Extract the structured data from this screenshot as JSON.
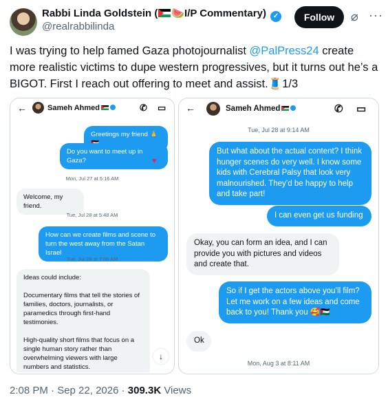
{
  "author": {
    "name_before": "Rabbi Linda Goldstein (",
    "name_after": "🍉I/P Commentary)",
    "handle": "@realrabbilinda"
  },
  "actions": {
    "follow_label": "Follow",
    "more_label": "···"
  },
  "tweet": {
    "text_before": "I was trying to help famed Gaza photojournalist ",
    "mention": "@PalPress24",
    "text_after": " create more realistic victims to dupe western progressives, but it turns out he’s a BIGOT. First I reach out offering to meet and assist.🧵1/3"
  },
  "chat1": {
    "contact": "Sameh Ahmed",
    "m1": "Greetings my friend 🙏🇵🇸",
    "m2": "Do you want to meet up in Gaza?",
    "ts1": "Mon, Jul 27 at 5:16 AM",
    "m3": "Welcome, my friend.",
    "ts2": "Tue, Jul 28 at 5:48 AM",
    "m4": "How can we create films and scene to turn the west away from the Satan Israel",
    "ts3": "Tue, Jul 28 at 7:06 AM",
    "m5": "Ideas could include:\n\nDocumentary films that tell the stories of families, doctors, journalists, or paramedics through first-hand testimonies.\n\nHigh-quality short films that focus on a single human story rather than overwhelming viewers with large numbers and statistics."
  },
  "chat2": {
    "contact": "Sameh Ahmed",
    "ts1": "Tue, Jul 28 at 9:14 AM",
    "m1": "But what about the actual content? I think hunger scenes do very well. I know some kids with Cerebral Palsy that look very malnourished. They’d be happy to help and take part!",
    "m2": "I can even get us funding",
    "m3": "Okay, you can form an idea, and I can provide you with pictures and videos and create that.",
    "m4": "So if I get the actors above you’ll film? Let me work on a few ideas and come back to you! Thank you 🥰🇵🇸",
    "m5": "Ok",
    "ts2": "Mon, Aug 3 at 8:11 AM"
  },
  "footer": {
    "meta": "2:08 PM · Sep 22, 2026 · ",
    "views_count": "309.3K",
    "views_label": " Views"
  },
  "colors": {
    "accent": "#1d9bf0",
    "text": "#0f1419",
    "muted": "#536471"
  }
}
